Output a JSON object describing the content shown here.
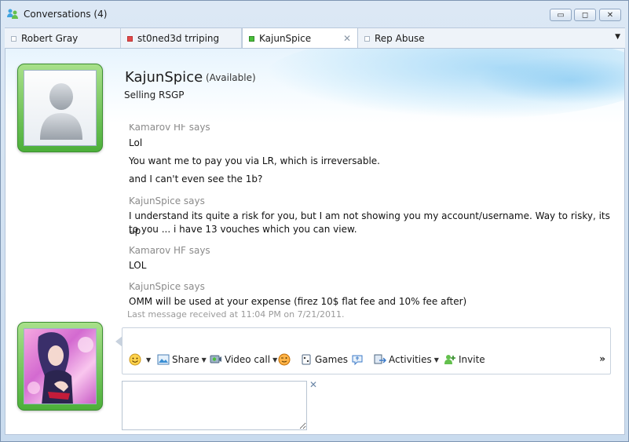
{
  "window": {
    "title": "Conversations (4)",
    "controls": {
      "minimize": "▭",
      "restore": "◻",
      "close": "✕"
    }
  },
  "tabs": [
    {
      "label": "Robert Gray",
      "status_color": "#ffffff",
      "active": false
    },
    {
      "label": "st0ned3d trriping",
      "status_color": "#e24a4a",
      "active": false
    },
    {
      "label": "KajunSpice",
      "status_color": "#4bbf3a",
      "active": true
    },
    {
      "label": "Rep Abuse",
      "status_color": "#ffffff",
      "active": false
    }
  ],
  "tab_close": "✕",
  "tab_dropdown": "▼",
  "contact": {
    "name": "KajunSpice",
    "status": "(Available)",
    "personal_message": "Selling RSGP"
  },
  "messages": [
    {
      "sender": "Kamarov HF says",
      "lines": [
        "Lol",
        "You want me to pay you via LR, which is irreversable.",
        "and I can't even see the 1b?"
      ]
    },
    {
      "sender": "KajunSpice says",
      "lines": [
        "I understand its quite a risk for you, but I am not showing you my account/username. Way to risky, its up",
        "to you ... i have 13 vouches which you can view."
      ]
    },
    {
      "sender": "Kamarov HF says",
      "lines": [
        "LOL"
      ]
    },
    {
      "sender": "KajunSpice says",
      "lines": [
        "OMM will be  used at your expense (firez 10$ flat fee and 10% fee after)"
      ]
    }
  ],
  "last_message_note": "Last message received at 11:04 PM on 7/21/2011.",
  "toolbar": {
    "share": "Share",
    "video_call": "Video call",
    "games": "Games",
    "activities": "Activities",
    "invite": "Invite",
    "more": "»",
    "dropdown_glyph": "▼"
  },
  "input": {
    "value": "",
    "close_glyph": "✕"
  },
  "colors": {
    "frame_green": "#4caf3a",
    "accent_blue": "#3b7ac8"
  }
}
